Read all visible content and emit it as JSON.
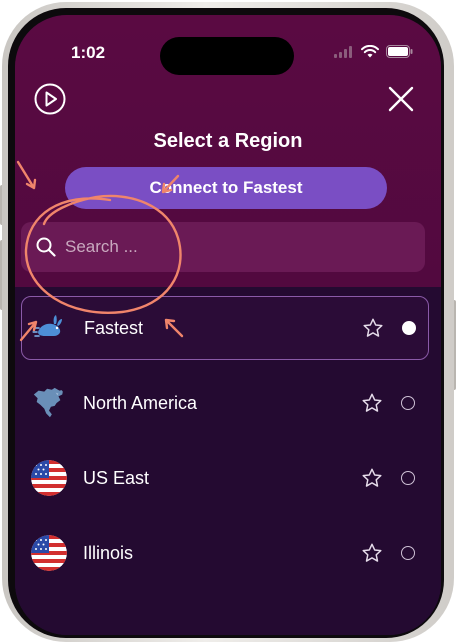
{
  "status_bar": {
    "time": "1:02"
  },
  "header": {
    "title": "Select a Region"
  },
  "connect_button": {
    "label": "Connect to Fastest"
  },
  "search": {
    "placeholder": "Search ..."
  },
  "regions": [
    {
      "name": "Fastest",
      "icon": "rabbit-icon",
      "selected": true
    },
    {
      "name": "North America",
      "icon": "north-america-map-icon",
      "selected": false
    },
    {
      "name": "US East",
      "icon": "us-flag-icon",
      "selected": false
    },
    {
      "name": "Illinois",
      "icon": "us-flag-icon",
      "selected": false
    }
  ],
  "colors": {
    "header_bg": "#5a0a42",
    "list_bg": "#240a31",
    "accent": "#7a4ec4",
    "annotation": "#f0856b"
  }
}
